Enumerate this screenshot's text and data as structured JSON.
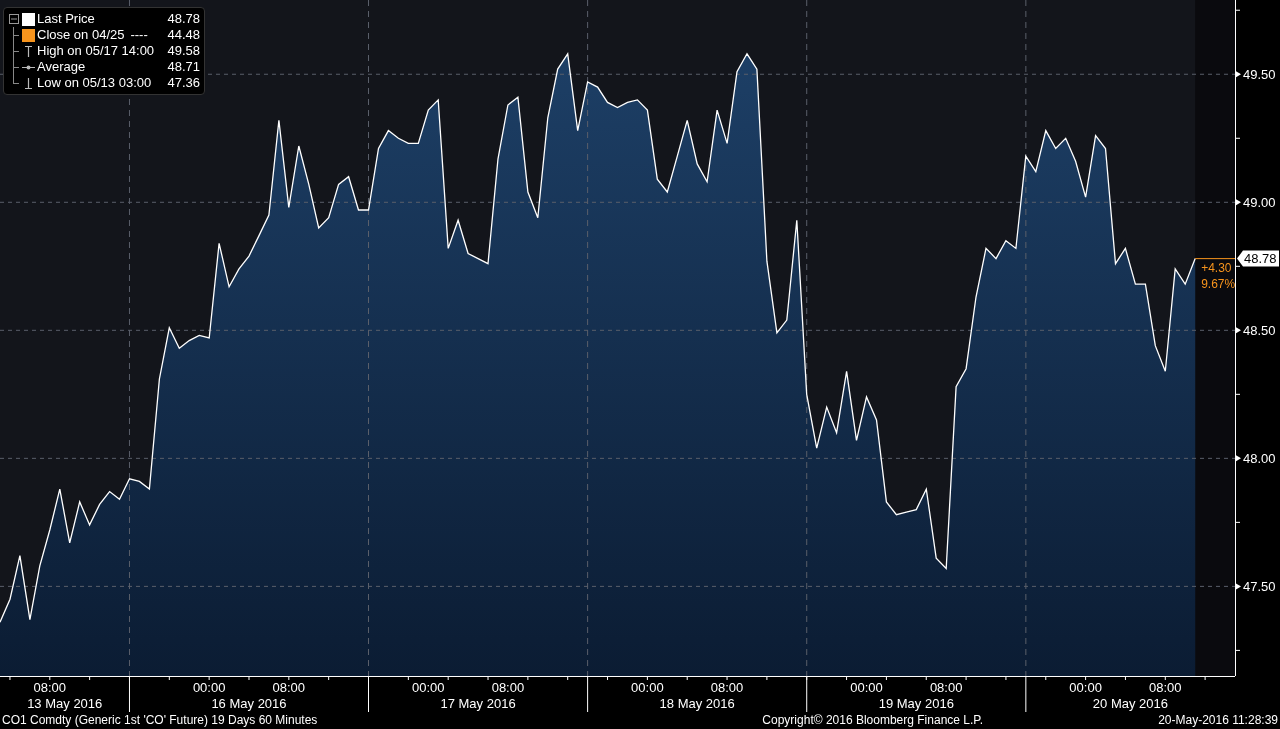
{
  "legend": {
    "items": [
      {
        "kind": "series",
        "color": "#ffffff",
        "value": "48.78"
      },
      {
        "kind": "box",
        "color": "#f7941d",
        "label": "Close on 04/25",
        "line_sample": "----",
        "value": "44.48"
      },
      {
        "kind": "high",
        "label": "High on 05/17 14:00",
        "value": "49.58"
      },
      {
        "kind": "average",
        "label": "Average",
        "value": "48.71"
      },
      {
        "kind": "low",
        "label": "Low on 05/13 03:00",
        "value": "47.36"
      }
    ]
  },
  "chart_data": {
    "type": "area",
    "grid": true,
    "ylim": [
      47.15,
      49.79
    ],
    "categories": [
      null,
      null,
      null,
      null,
      null,
      "08:00",
      null,
      null,
      null,
      null,
      null,
      null,
      null,
      null,
      null,
      null,
      null,
      null,
      null,
      null,
      null,
      "00:00",
      null,
      null,
      null,
      null,
      null,
      null,
      null,
      "08:00",
      null,
      null,
      null,
      null,
      null,
      null,
      null,
      null,
      null,
      null,
      null,
      null,
      null,
      "00:00",
      null,
      null,
      null,
      null,
      null,
      null,
      null,
      "08:00",
      null,
      null,
      null,
      null,
      null,
      null,
      null,
      null,
      null,
      null,
      null,
      null,
      null,
      "00:00",
      null,
      null,
      null,
      null,
      null,
      null,
      null,
      "08:00",
      null,
      null,
      null,
      null,
      null,
      null,
      null,
      null,
      null,
      null,
      null,
      null,
      null,
      "00:00",
      null,
      null,
      null,
      null,
      null,
      null,
      null,
      "08:00",
      null,
      null,
      null,
      null,
      null,
      null,
      null,
      null,
      null,
      null,
      null,
      null,
      null,
      "00:00",
      null,
      null,
      null,
      null,
      null,
      null,
      null,
      "08:00",
      null,
      null,
      null
    ],
    "yticks": [
      {
        "value": 49.5,
        "label": "49.50"
      },
      {
        "value": 49,
        "label": "49.00"
      },
      {
        "value": 48.5,
        "label": "48.50"
      },
      {
        "value": 48,
        "label": "48.00"
      },
      {
        "value": 47.5,
        "label": "47.50"
      }
    ],
    "series": [
      {
        "name": "Last Price",
        "color": "#ffffff",
        "values": [
          47.36,
          47.45,
          47.62,
          47.37,
          47.58,
          47.72,
          47.88,
          47.67,
          47.83,
          47.74,
          47.82,
          47.87,
          47.84,
          47.92,
          47.91,
          47.88,
          48.31,
          48.51,
          48.43,
          48.46,
          48.48,
          48.47,
          48.84,
          48.67,
          48.74,
          48.79,
          48.87,
          48.95,
          49.32,
          48.98,
          49.22,
          49.07,
          48.9,
          48.94,
          49.07,
          49.1,
          48.97,
          48.97,
          49.21,
          49.28,
          49.25,
          49.23,
          49.23,
          49.36,
          49.4,
          48.82,
          48.93,
          48.8,
          48.78,
          48.76,
          49.17,
          49.38,
          49.41,
          49.04,
          48.94,
          49.33,
          49.52,
          49.58,
          49.28,
          49.47,
          49.45,
          49.39,
          49.37,
          49.39,
          49.4,
          49.36,
          49.09,
          49.04,
          49.18,
          49.32,
          49.15,
          49.08,
          49.36,
          49.23,
          49.51,
          49.58,
          49.52,
          48.77,
          48.49,
          48.54,
          48.93,
          48.25,
          48.04,
          48.2,
          48.1,
          48.34,
          48.07,
          48.24,
          48.15,
          47.83,
          47.78,
          47.79,
          47.8,
          47.88,
          47.61,
          47.57,
          48.28,
          48.35,
          48.63,
          48.82,
          48.78,
          48.85,
          48.82,
          49.18,
          49.12,
          49.28,
          49.21,
          49.25,
          49.16,
          49.02,
          49.26,
          49.21,
          48.76,
          48.82,
          48.68,
          48.68,
          48.44,
          48.34,
          48.74,
          48.68,
          48.78
        ]
      }
    ]
  },
  "x_axis_dates": [
    "13 May 2016",
    "16 May 2016",
    "17 May 2016",
    "18 May 2016",
    "19 May 2016",
    "20 May 2016"
  ],
  "last_price_tag": {
    "value": "48.78",
    "change": "+4.30",
    "change_pct": "9.67%"
  },
  "footer": {
    "security": "CO1 Comdty (Generic 1st 'CO' Future) 19 Days 60 Minutes",
    "copyright": "Copyright© 2016 Bloomberg Finance L.P.",
    "timestamp": "20-May-2016 11:28:39"
  }
}
